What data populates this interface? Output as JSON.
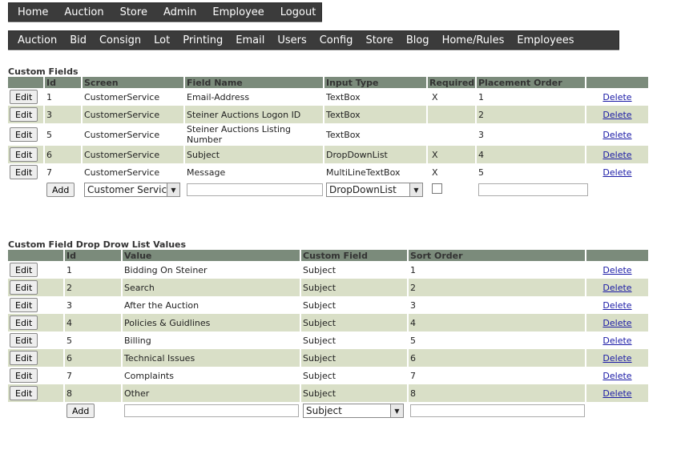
{
  "nav_primary": [
    "Home",
    "Auction",
    "Store",
    "Admin",
    "Employee",
    "Logout"
  ],
  "nav_secondary": [
    "Auction",
    "Bid",
    "Consign",
    "Lot",
    "Printing",
    "Email",
    "Users",
    "Config",
    "Store",
    "Blog",
    "Home/Rules",
    "Employees"
  ],
  "custom_fields": {
    "title": "Custom Fields",
    "headers": [
      "",
      "Id",
      "Screen",
      "Field Name",
      "Input Type",
      "Required",
      "Placement Order",
      ""
    ],
    "rows": [
      {
        "id": "1",
        "screen": "CustomerService",
        "field_name": "Email-Address",
        "input_type": "TextBox",
        "required": "X",
        "order": "1"
      },
      {
        "id": "3",
        "screen": "CustomerService",
        "field_name": "Steiner Auctions Logon ID",
        "input_type": "TextBox",
        "required": "",
        "order": "2"
      },
      {
        "id": "5",
        "screen": "CustomerService",
        "field_name": "Steiner Auctions Listing Number",
        "input_type": "TextBox",
        "required": "",
        "order": "3"
      },
      {
        "id": "6",
        "screen": "CustomerService",
        "field_name": "Subject",
        "input_type": "DropDownList",
        "required": "X",
        "order": "4"
      },
      {
        "id": "7",
        "screen": "CustomerService",
        "field_name": "Message",
        "input_type": "MultiLineTextBox",
        "required": "X",
        "order": "5"
      }
    ],
    "edit_label": "Edit",
    "delete_label": "Delete",
    "add_label": "Add",
    "add_screen_value": "Customer Service",
    "add_input_type_value": "DropDownList"
  },
  "dropdown_values": {
    "title": "Custom Field Drop Drow List Values",
    "headers": [
      "",
      "Id",
      "Value",
      "Custom Field",
      "Sort Order",
      ""
    ],
    "rows": [
      {
        "id": "1",
        "value": "Bidding On Steiner",
        "field": "Subject",
        "sort": "1"
      },
      {
        "id": "2",
        "value": "Search",
        "field": "Subject",
        "sort": "2"
      },
      {
        "id": "3",
        "value": "After the Auction",
        "field": "Subject",
        "sort": "3"
      },
      {
        "id": "4",
        "value": "Policies & Guidlines",
        "field": "Subject",
        "sort": "4"
      },
      {
        "id": "5",
        "value": "Billing",
        "field": "Subject",
        "sort": "5"
      },
      {
        "id": "6",
        "value": "Technical Issues",
        "field": "Subject",
        "sort": "6"
      },
      {
        "id": "7",
        "value": "Complaints",
        "field": "Subject",
        "sort": "7"
      },
      {
        "id": "8",
        "value": "Other",
        "field": "Subject",
        "sort": "8"
      }
    ],
    "edit_label": "Edit",
    "delete_label": "Delete",
    "add_label": "Add",
    "add_field_value": "Subject"
  },
  "colors": {
    "header_bg": "#7b8b7b",
    "alt_row": "#d9dfc7",
    "nav_bg": "#3b3b3b",
    "link": "#1a1aa6"
  }
}
